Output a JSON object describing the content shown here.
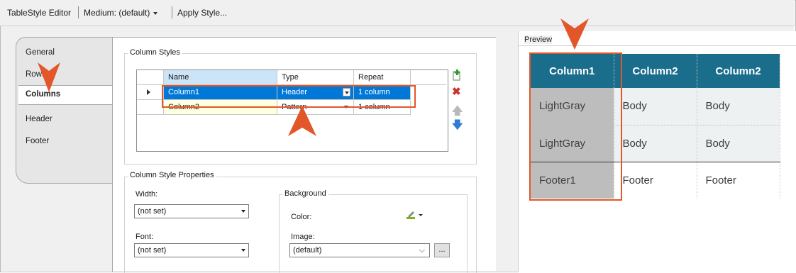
{
  "toolbar": {
    "title": "TableStyle Editor",
    "medium": "Medium: (default)",
    "apply": "Apply Style..."
  },
  "tabs": [
    "General",
    "Rows",
    "Columns",
    "Header",
    "Footer"
  ],
  "active_tab": "Columns",
  "column_styles": {
    "label": "Column Styles",
    "headers": [
      "Name",
      "Type",
      "Repeat"
    ],
    "rows": [
      {
        "name": "Column1",
        "type": "Header",
        "repeat": "1 column",
        "selected": true
      },
      {
        "name": "Column2",
        "type": "Pattern",
        "repeat": "1 column",
        "selected": false
      }
    ],
    "buttons": [
      "add-icon",
      "delete-icon",
      "move-up-icon",
      "move-down-icon"
    ]
  },
  "properties": {
    "label": "Column Style Properties",
    "width_label": "Width:",
    "width_value": "(not set)",
    "font_label": "Font:",
    "font_value": "(not set)",
    "background_label": "Background",
    "color_label": "Color:",
    "image_label": "Image:",
    "image_value": "(default)",
    "browse": "..."
  },
  "preview": {
    "label": "Preview",
    "header": [
      "Column1",
      "Column2",
      "Column2"
    ],
    "body": [
      [
        "LightGray",
        "Body",
        "Body"
      ],
      [
        "LightGray",
        "Body",
        "Body"
      ]
    ],
    "footer": [
      "Footer1",
      "Footer",
      "Footer"
    ]
  },
  "colors": {
    "accent": "#e2572a",
    "header_bg": "#1a6e8c",
    "selection": "#0078d7"
  }
}
